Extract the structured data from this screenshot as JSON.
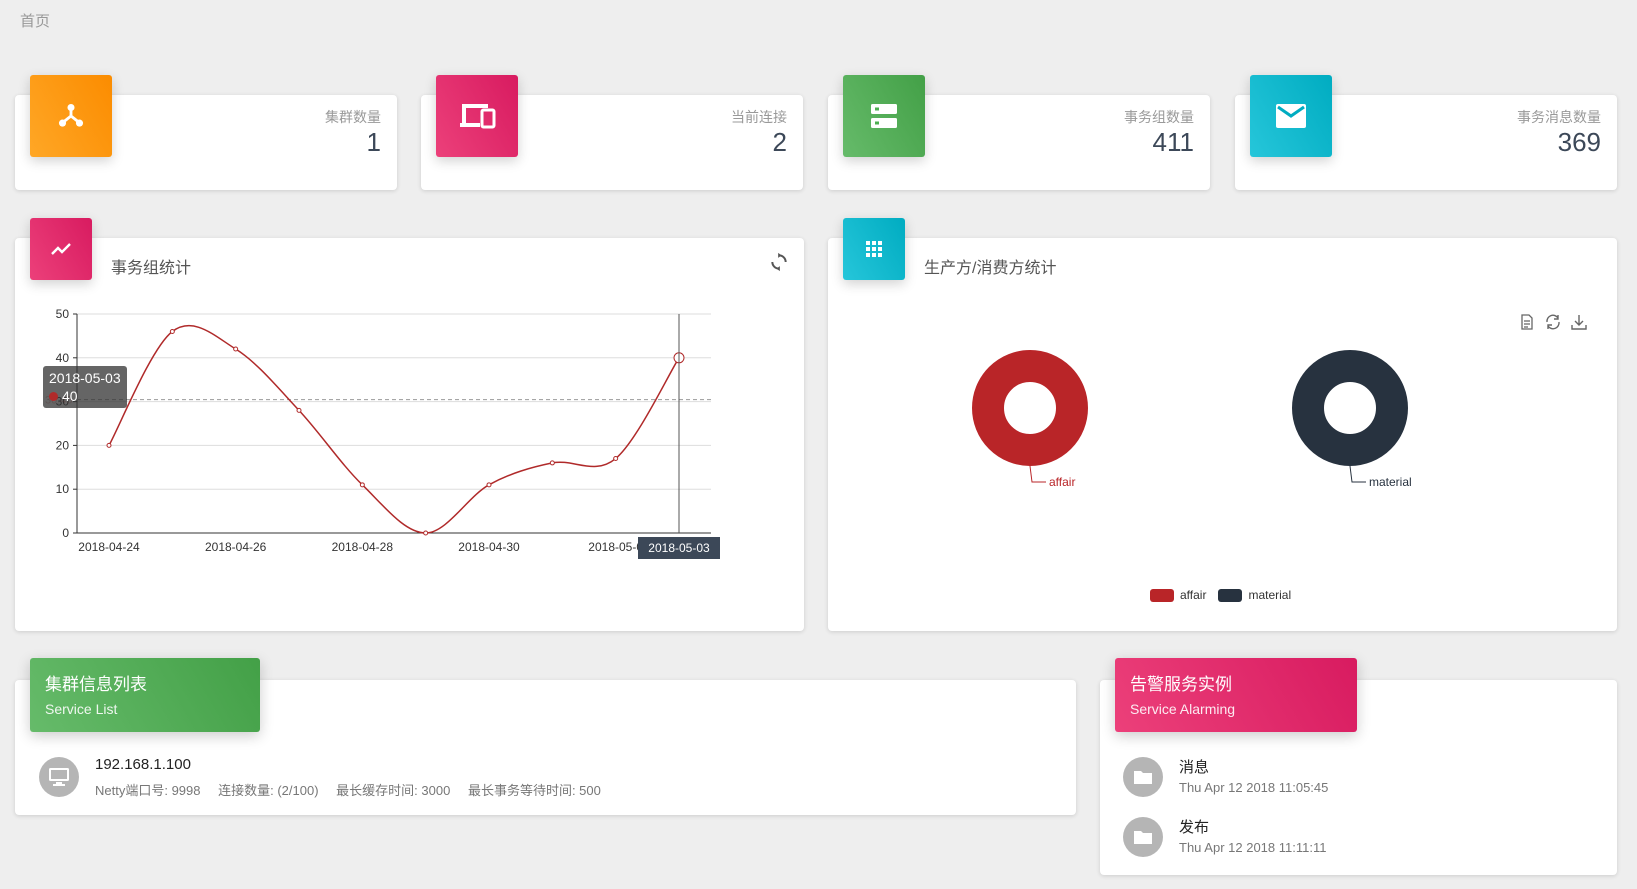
{
  "breadcrumb": "首页",
  "stats": [
    {
      "label": "集群数量",
      "value": "1",
      "icon": "cluster-icon",
      "color": "orange"
    },
    {
      "label": "当前连接",
      "value": "2",
      "icon": "devices-icon",
      "color": "pink"
    },
    {
      "label": "事务组数量",
      "value": "411",
      "icon": "storage-icon",
      "color": "green"
    },
    {
      "label": "事务消息数量",
      "value": "369",
      "icon": "mail-icon",
      "color": "cyan"
    }
  ],
  "line_panel": {
    "title": "事务组统计",
    "tooltip_date": "2018-05-03",
    "tooltip_value": "40",
    "axis_pointer_label": "2018-05-03",
    "markline_label": "30.45"
  },
  "pie_panel": {
    "title": "生产方/消费方统计",
    "legend": [
      "affair",
      "material"
    ]
  },
  "chart_data": [
    {
      "type": "line",
      "x": [
        "2018-04-24",
        "2018-04-25",
        "2018-04-26",
        "2018-04-27",
        "2018-04-28",
        "2018-04-29",
        "2018-04-30",
        "2018-05-01",
        "2018-05-02",
        "2018-05-03"
      ],
      "xticks": [
        "2018-04-24",
        "2018-04-26",
        "2018-04-28",
        "2018-04-30",
        "2018-05-0"
      ],
      "series": [
        {
          "values": [
            20,
            46,
            42,
            28,
            11,
            0,
            11,
            16,
            17,
            40
          ]
        }
      ],
      "ylim": [
        0,
        50
      ],
      "yticks": [
        0,
        10,
        20,
        30,
        40,
        50
      ],
      "color": "#b02a2a",
      "grid": true
    },
    {
      "type": "pie",
      "series": [
        {
          "name": "affair",
          "color": "#b92528"
        },
        {
          "name": "material",
          "color": "#27323f"
        }
      ]
    }
  ],
  "cluster_list": {
    "title": "集群信息列表",
    "subtitle": "Service List",
    "items": [
      {
        "address": "192.168.1.100",
        "netty_port": "Netty端口号: 9998",
        "connections": "连接数量: (2/100)",
        "cache_time": "最长缓存时间: 3000",
        "wait_time": "最长事务等待时间: 500"
      }
    ]
  },
  "alarm_list": {
    "title": "告警服务实例",
    "subtitle": "Service Alarming",
    "items": [
      {
        "title": "消息",
        "time": "Thu Apr 12 2018 11:05:45"
      },
      {
        "title": "发布",
        "time": "Thu Apr 12 2018 11:11:11"
      }
    ]
  }
}
